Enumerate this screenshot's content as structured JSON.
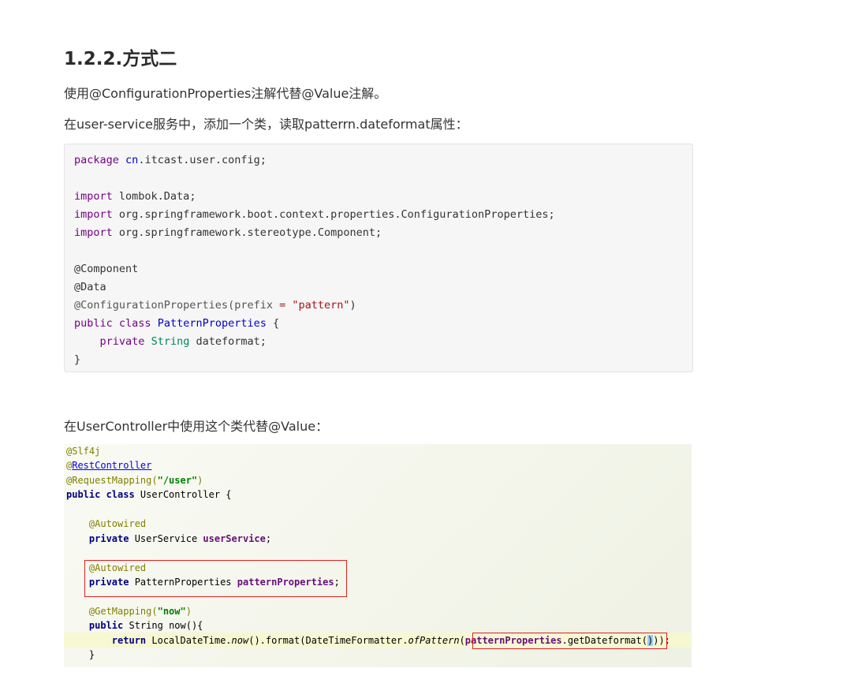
{
  "heading": "1.2.2.方式二",
  "para1": "使用@ConfigurationProperties注解代替@Value注解。",
  "para2": "在user-service服务中，添加一个类，读取patterrn.dateformat属性：",
  "para3": "在UserController中使用这个类代替@Value：",
  "code1": {
    "l1": [
      "package",
      "cn",
      ".itcast.user.config;"
    ],
    "l3": [
      "import",
      " lombok.Data;"
    ],
    "l4": [
      "import",
      " org.springframework.boot.context.properties.ConfigurationProperties;"
    ],
    "l5": [
      "import",
      " org.springframework.stereotype.Component;"
    ],
    "l7": "@Component",
    "l8": "@Data",
    "l9": [
      "@ConfigurationProperties(prefix ",
      "=",
      " ",
      "\"pattern\"",
      ")"
    ],
    "l10": [
      "public",
      "class",
      "PatternProperties",
      " {"
    ],
    "l11": [
      "private",
      "String",
      " dateformat;"
    ],
    "l12": "}"
  },
  "ide": {
    "a1": "@Slf4j",
    "a2_at": "@",
    "a2_name": "RestController",
    "a3_ann": "@RequestMapping(",
    "a3_str": "\"/user\"",
    "a3_end": ")",
    "c1_kw": "public class",
    "c1_rest": " UserController {",
    "f1_ann": "@Autowired",
    "f1_kw": "private",
    "f1_type": " UserService ",
    "f1_name": "userService",
    "f1_end": ";",
    "f2_ann": "@Autowired",
    "f2_kw": "private",
    "f2_type": " PatternProperties ",
    "f2_name": "patternProperties",
    "f2_end": ";",
    "m_ann": "@GetMapping(",
    "m_str": "\"now\"",
    "m_end": ")",
    "m_kw": "public",
    "m_rest": " String now(){",
    "r_kw": "return",
    "r_a": " LocalDateTime.",
    "r_now": "now",
    "r_b": "().format(DateTimeFormatter.",
    "r_of": "ofPattern",
    "r_c": "(",
    "r_fld": "patternProperties",
    "r_d": ".getDateformat(",
    "r_e": ")",
    "r_f": "));",
    "close": "}"
  }
}
